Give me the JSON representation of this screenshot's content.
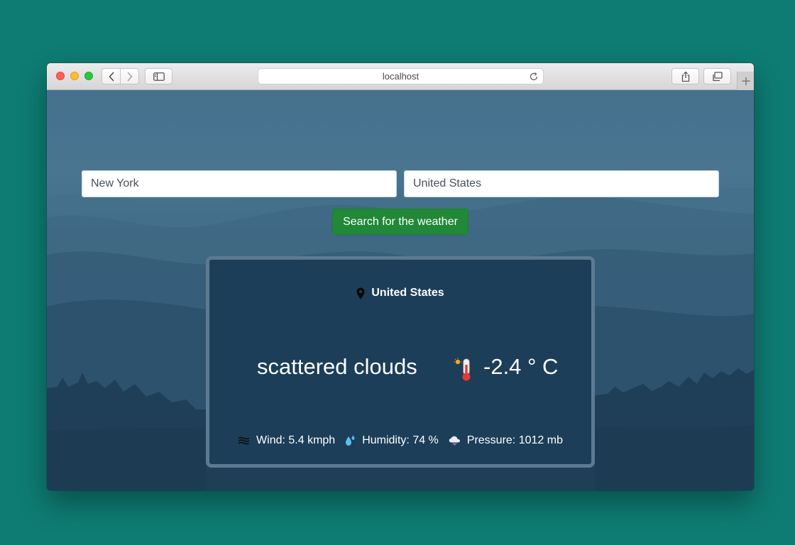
{
  "browser": {
    "address": "localhost",
    "icons": {
      "close": "close-dot-red",
      "minimize": "minimize-dot-yellow",
      "maximize": "maximize-dot-green",
      "back": "chevron-left-icon",
      "forward": "chevron-right-icon",
      "sidebar": "sidebar-icon",
      "reload": "reload-icon",
      "share": "share-icon",
      "tabs": "tabs-overview-icon",
      "new_tab": "plus-icon"
    },
    "new_tab_glyph": "+"
  },
  "search": {
    "city_value": "New York",
    "country_value": "United States",
    "button_label": "Search for the weather",
    "button_color": "#218838"
  },
  "weather": {
    "location": "United States",
    "description": "scattered clouds",
    "temperature": "-2.4 ° C",
    "wind": "Wind: 5.4 kmph",
    "humidity": "Humidity: 74 %",
    "pressure": "Pressure: 1012 mb",
    "icons": {
      "location": "map-pin-icon",
      "temperature": "thermometer-icon",
      "wind": "wind-icon",
      "humidity": "droplet-icon",
      "pressure": "cloud-pressure-icon"
    }
  },
  "colors": {
    "desktop": "#0e7c73",
    "card_background": "#1c3e58",
    "card_border": "#5c7a92"
  }
}
